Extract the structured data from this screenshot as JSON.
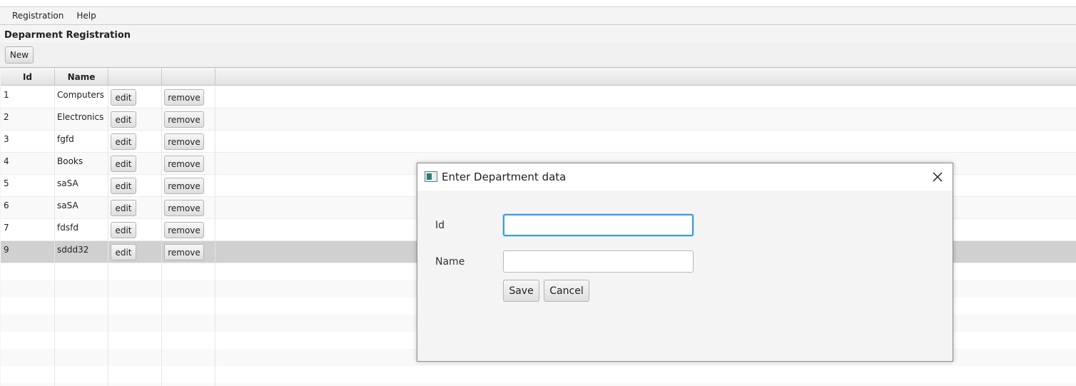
{
  "menu": [
    "Registration",
    "Help"
  ],
  "page_title": "Deparment Registration",
  "toolbar": {
    "new_label": "New"
  },
  "table": {
    "columns": [
      "Id",
      "Name",
      "",
      ""
    ],
    "rows": [
      {
        "id": "1",
        "name": "Computers"
      },
      {
        "id": "2",
        "name": "Electronics"
      },
      {
        "id": "3",
        "name": "fgfd"
      },
      {
        "id": "4",
        "name": "Books"
      },
      {
        "id": "5",
        "name": "saSA"
      },
      {
        "id": "6",
        "name": "saSA"
      },
      {
        "id": "7",
        "name": "fdsfd"
      },
      {
        "id": "9",
        "name": "sddd32",
        "selected": true
      }
    ],
    "edit_label": "edit",
    "remove_label": "remove"
  },
  "dialog": {
    "title": "Enter Department data",
    "id_label": "Id",
    "name_label": "Name",
    "id_value": "",
    "name_value": "",
    "save_label": "Save",
    "cancel_label": "Cancel"
  },
  "colors": {
    "focus": "#3a9ad9",
    "selected_row": "#d0d0d0"
  }
}
